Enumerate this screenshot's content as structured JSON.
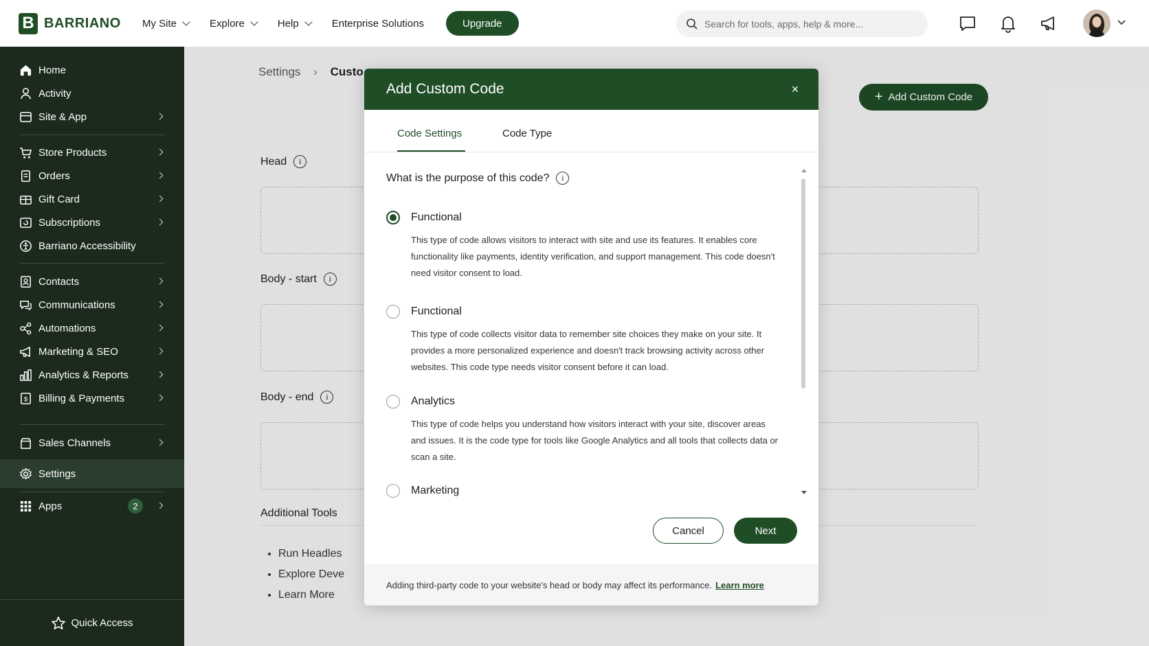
{
  "brand": {
    "logo_letter": "B",
    "name": "BARRIANO"
  },
  "topnav": {
    "items": [
      {
        "label": "My Site"
      },
      {
        "label": "Explore"
      },
      {
        "label": "Help"
      },
      {
        "label": "Enterprise Solutions"
      }
    ],
    "upgrade_label": "Upgrade",
    "search_placeholder": "Search for tools, apps, help & more..."
  },
  "sidebar": {
    "items": [
      {
        "label": "Home",
        "icon": "home-icon"
      },
      {
        "label": "Activity",
        "icon": "activity-icon"
      },
      {
        "label": "Site & App",
        "icon": "site-app-icon"
      },
      {
        "label": "Store Products",
        "icon": "cart-icon"
      },
      {
        "label": "Orders",
        "icon": "orders-icon"
      },
      {
        "label": "Gift Card",
        "icon": "gift-card-icon"
      },
      {
        "label": "Subscriptions",
        "icon": "subscriptions-icon"
      },
      {
        "label": "Barriano Accessibility",
        "icon": "accessibility-icon"
      },
      {
        "label": "Contacts",
        "icon": "contacts-icon"
      },
      {
        "label": "Communications",
        "icon": "communications-icon"
      },
      {
        "label": "Automations",
        "icon": "automations-icon"
      },
      {
        "label": "Marketing & SEO",
        "icon": "marketing-icon"
      },
      {
        "label": "Analytics & Reports",
        "icon": "analytics-icon"
      },
      {
        "label": "Billing & Payments",
        "icon": "billing-icon"
      },
      {
        "label": "Sales Channels",
        "icon": "sales-channels-icon"
      },
      {
        "label": "Settings",
        "icon": "settings-icon"
      },
      {
        "label": "Apps",
        "icon": "apps-icon",
        "badge": "2"
      }
    ],
    "quick_access": "Quick Access"
  },
  "page": {
    "breadcrumb_root": "Settings",
    "breadcrumb_current": "Custo",
    "add_button": "Add Custom Code",
    "sections": [
      {
        "label": "Head"
      },
      {
        "label": "Body - start"
      },
      {
        "label": "Body - end"
      }
    ],
    "additional_tools": {
      "title": "Additional Tools",
      "items": [
        "Run Headles",
        "Explore Deve",
        "Learn More"
      ]
    }
  },
  "modal": {
    "title": "Add Custom Code",
    "close": "×",
    "tabs": [
      {
        "label": "Code Settings"
      },
      {
        "label": "Code Type"
      }
    ],
    "question": "What is the purpose of this code?",
    "options": [
      {
        "title": "Functional",
        "selected": true,
        "desc": "This type of code allows visitors to interact with site and use its features. It enables core functionality like payments, identity verification, and support management. This code doesn't need visitor consent to load."
      },
      {
        "title": "Functional",
        "selected": false,
        "desc": "This type of code collects visitor data to remember site choices they make on your site. It provides a more personalized experience and doesn't track browsing activity across other websites. This code type needs visitor consent before it can load."
      },
      {
        "title": "Analytics",
        "selected": false,
        "desc": "This type of code helps you understand how visitors interact with your site, discover areas and issues. It is the code type for tools like Google Analytics and all tools that collects data or scan a site."
      },
      {
        "title": "Marketing",
        "selected": false,
        "desc": ""
      }
    ],
    "cancel_label": "Cancel",
    "next_label": "Next",
    "footer_text": "Adding third-party code to your website's head or body may affect its performance.",
    "footer_link": "Learn more"
  },
  "colors": {
    "brand": "#1f4d26",
    "sidebar_bg": "#1b2a1d"
  }
}
